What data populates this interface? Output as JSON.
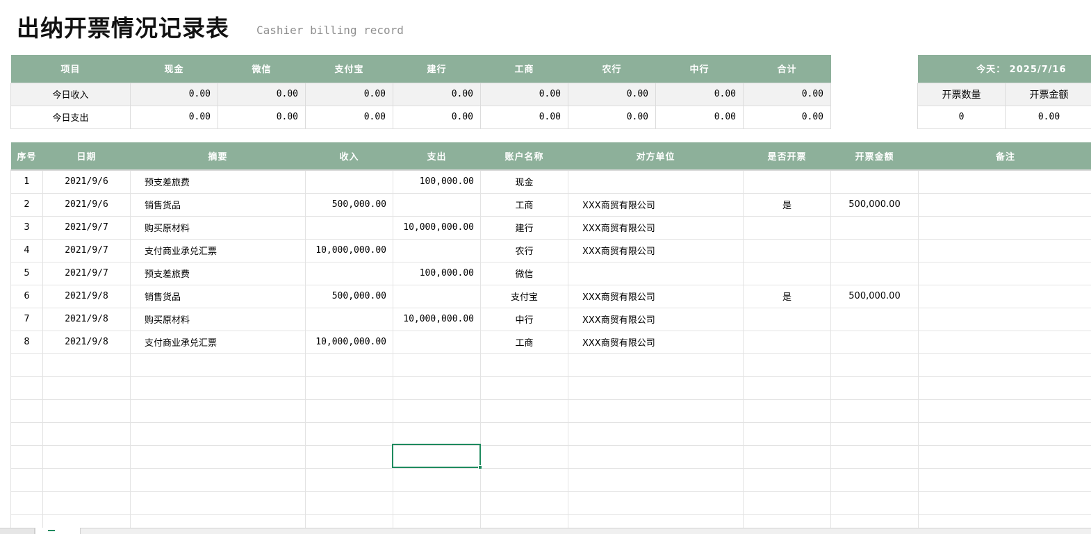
{
  "header": {
    "title": "出纳开票情况记录表",
    "subtitle": "Cashier billing record"
  },
  "summary": {
    "columns": [
      "项目",
      "现金",
      "微信",
      "支付宝",
      "建行",
      "工商",
      "农行",
      "中行",
      "合计"
    ],
    "rows": [
      {
        "label": "今日收入",
        "values": [
          "0.00",
          "0.00",
          "0.00",
          "0.00",
          "0.00",
          "0.00",
          "0.00",
          "0.00"
        ]
      },
      {
        "label": "今日支出",
        "values": [
          "0.00",
          "0.00",
          "0.00",
          "0.00",
          "0.00",
          "0.00",
          "0.00",
          "0.00"
        ]
      }
    ]
  },
  "stats": {
    "today": "今天： 2025/7/16",
    "count_label": "开票数量",
    "amount_label": "开票金额",
    "count": "0",
    "amount": "0.00"
  },
  "records": {
    "columns": [
      "序号",
      "日期",
      "摘要",
      "收入",
      "支出",
      "账户名称",
      "对方单位",
      "是否开票",
      "开票金额",
      "备注"
    ],
    "rows": [
      [
        "1",
        "2021/9/6",
        "预支差旅费",
        "",
        "100,000.00",
        "现金",
        "",
        "",
        "",
        ""
      ],
      [
        "2",
        "2021/9/6",
        "销售货品",
        "500,000.00",
        "",
        "工商",
        "XXX商贸有限公司",
        "是",
        "500,000.00",
        ""
      ],
      [
        "3",
        "2021/9/7",
        "购买原材料",
        "",
        "10,000,000.00",
        "建行",
        "XXX商贸有限公司",
        "",
        "",
        ""
      ],
      [
        "4",
        "2021/9/7",
        "支付商业承兑汇票",
        "10,000,000.00",
        "",
        "农行",
        "XXX商贸有限公司",
        "",
        "",
        ""
      ],
      [
        "5",
        "2021/9/7",
        "预支差旅费",
        "",
        "100,000.00",
        "微信",
        "",
        "",
        "",
        ""
      ],
      [
        "6",
        "2021/9/8",
        "销售货品",
        "500,000.00",
        "",
        "支付宝",
        "XXX商贸有限公司",
        "是",
        "500,000.00",
        ""
      ],
      [
        "7",
        "2021/9/8",
        "购买原材料",
        "",
        "10,000,000.00",
        "中行",
        "XXX商贸有限公司",
        "",
        "",
        ""
      ],
      [
        "8",
        "2021/9/8",
        "支付商业承兑汇票",
        "10,000,000.00",
        "",
        "工商",
        "XXX商贸有限公司",
        "",
        "",
        ""
      ],
      [
        "",
        "",
        "",
        "",
        "",
        "",
        "",
        "",
        "",
        ""
      ],
      [
        "",
        "",
        "",
        "",
        "",
        "",
        "",
        "",
        "",
        ""
      ],
      [
        "",
        "",
        "",
        "",
        "",
        "",
        "",
        "",
        "",
        ""
      ],
      [
        "",
        "",
        "",
        "",
        "",
        "",
        "",
        "",
        "",
        ""
      ],
      [
        "",
        "",
        "",
        "",
        "",
        "",
        "",
        "",
        "",
        ""
      ],
      [
        "",
        "",
        "",
        "",
        "",
        "",
        "",
        "",
        "",
        ""
      ],
      [
        "",
        "",
        "",
        "",
        "",
        "",
        "",
        "",
        "",
        ""
      ],
      [
        "",
        "",
        "",
        "",
        "",
        "",
        "",
        "",
        "",
        ""
      ]
    ]
  },
  "theme": {
    "header_bg": "#8db09a",
    "selection_color": "#1e8a5e"
  }
}
